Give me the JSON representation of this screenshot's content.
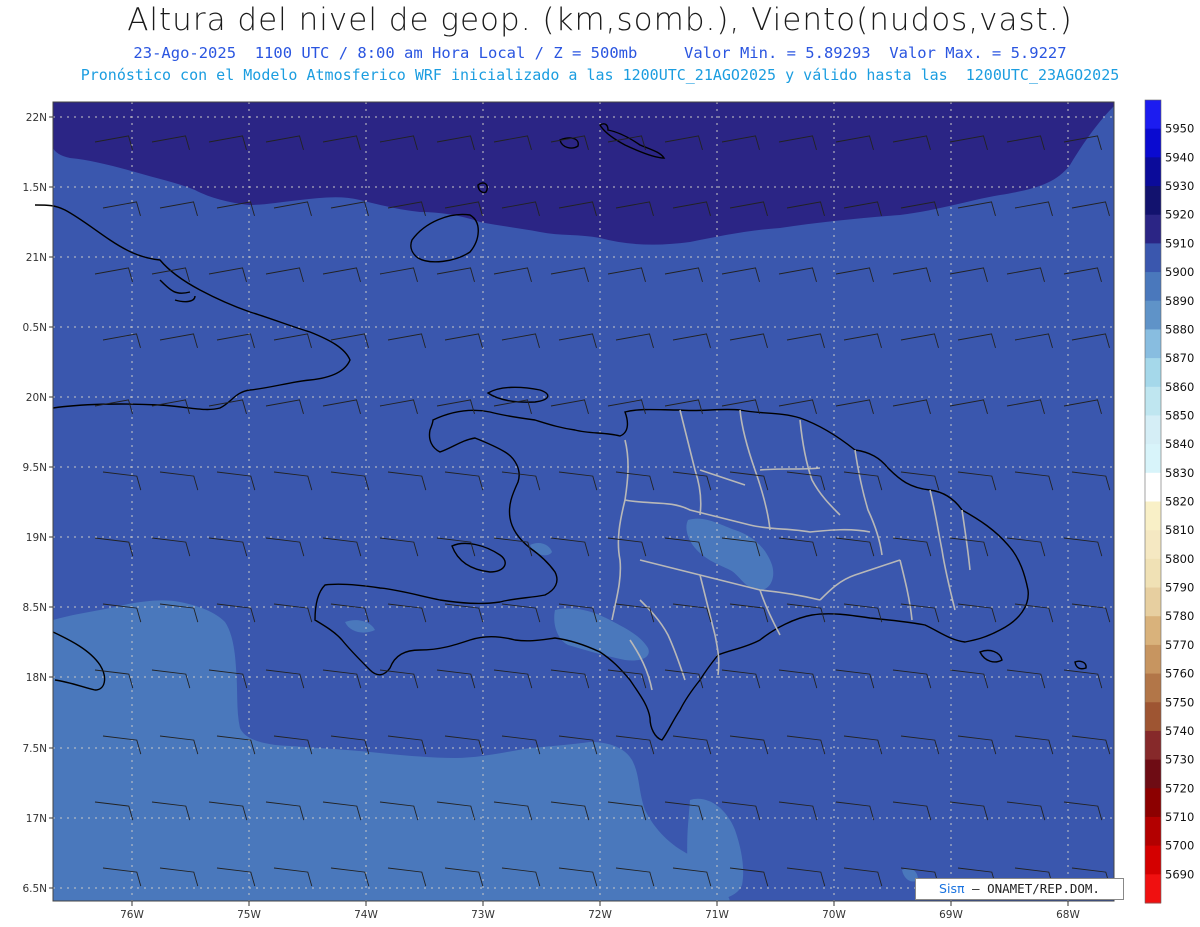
{
  "header": {
    "title": "Altura del nivel de geop. (km,somb.), Viento(nudos,vast.)",
    "subtitle_date": "23-Ago-2025  1100 UTC / 8:00 am Hora Local / Z = 500mb     Valor Min. = 5.89293  Valor Max. = 5.9227",
    "subtitle_model": "Pronóstico con el Modelo Atmosferico WRF inicializado a las 1200UTC_21AGO2025 y válido hasta las  1200UTC_23AGO2025"
  },
  "map": {
    "lat_labels": [
      "22N",
      "1.5N",
      "21N",
      "0.5N",
      "20N",
      "9.5N",
      "19N",
      "8.5N",
      "18N",
      "7.5N",
      "17N",
      "6.5N"
    ],
    "lon_labels": [
      "76W",
      "75W",
      "74W",
      "73W",
      "72W",
      "71W",
      "70W",
      "69W",
      "68W"
    ]
  },
  "colorbar": {
    "levels": [
      {
        "label": "5950",
        "color": "#1c1cf0"
      },
      {
        "label": "5940",
        "color": "#0a0ad0"
      },
      {
        "label": "5930",
        "color": "#0b0b9a"
      },
      {
        "label": "5920",
        "color": "#12126e"
      },
      {
        "label": "5910",
        "color": "#2b2585"
      },
      {
        "label": "5900",
        "color": "#3a57ae"
      },
      {
        "label": "5890",
        "color": "#4a78bc"
      },
      {
        "label": "5880",
        "color": "#5f93c8"
      },
      {
        "label": "5870",
        "color": "#88bde0"
      },
      {
        "label": "5860",
        "color": "#a5d8ea"
      },
      {
        "label": "5850",
        "color": "#bfe6f0"
      },
      {
        "label": "5840",
        "color": "#d5eef6"
      },
      {
        "label": "5830",
        "color": "#d8f4fa"
      },
      {
        "label": "5820",
        "color": "#ffffff"
      },
      {
        "label": "5810",
        "color": "#f9f0c7"
      },
      {
        "label": "5800",
        "color": "#f5e8c2"
      },
      {
        "label": "5790",
        "color": "#f0e1b5"
      },
      {
        "label": "5780",
        "color": "#e7cfa0"
      },
      {
        "label": "5770",
        "color": "#d9b27b"
      },
      {
        "label": "5760",
        "color": "#c79560"
      },
      {
        "label": "5750",
        "color": "#b27648"
      },
      {
        "label": "5740",
        "color": "#9e5532"
      },
      {
        "label": "5730",
        "color": "#86292a"
      },
      {
        "label": "5720",
        "color": "#6e0c14"
      },
      {
        "label": "5710",
        "color": "#8c0000"
      },
      {
        "label": "5700",
        "color": "#b30000"
      },
      {
        "label": "5690",
        "color": "#d40000"
      },
      {
        "label": "",
        "color": "#f01010"
      }
    ]
  },
  "credit": {
    "brand": "Sisπ",
    "text": "– ONAMET/REP.DOM."
  }
}
